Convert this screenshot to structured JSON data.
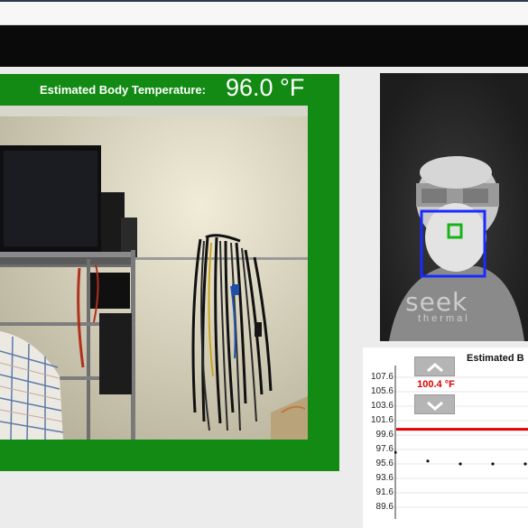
{
  "panel": {
    "temp_label": "Estimated Body Temperature:",
    "temp_value": "96.0 °F",
    "bg_color": "#138a13"
  },
  "thermal": {
    "logo": "seek",
    "logo_sub": "thermal",
    "box_color": "#1a2bff",
    "marker_color": "#17b317"
  },
  "threshold": {
    "value": "100.4 °F",
    "up_icon": "chevron-up-icon",
    "down_icon": "chevron-down-icon"
  },
  "chart_data": {
    "type": "line",
    "title": "Estimated B",
    "yticks": [
      "107.6",
      "105.6",
      "103.6",
      "101.6",
      "99.6",
      "97.6",
      "95.6",
      "93.6",
      "91.6",
      "89.6"
    ],
    "ylim": [
      89.6,
      107.6
    ],
    "threshold": 100.4,
    "threshold_color": "#e00000",
    "series": [
      {
        "values": [
          97.2,
          96.0,
          95.6,
          95.6,
          95.6,
          95.6
        ]
      }
    ]
  }
}
